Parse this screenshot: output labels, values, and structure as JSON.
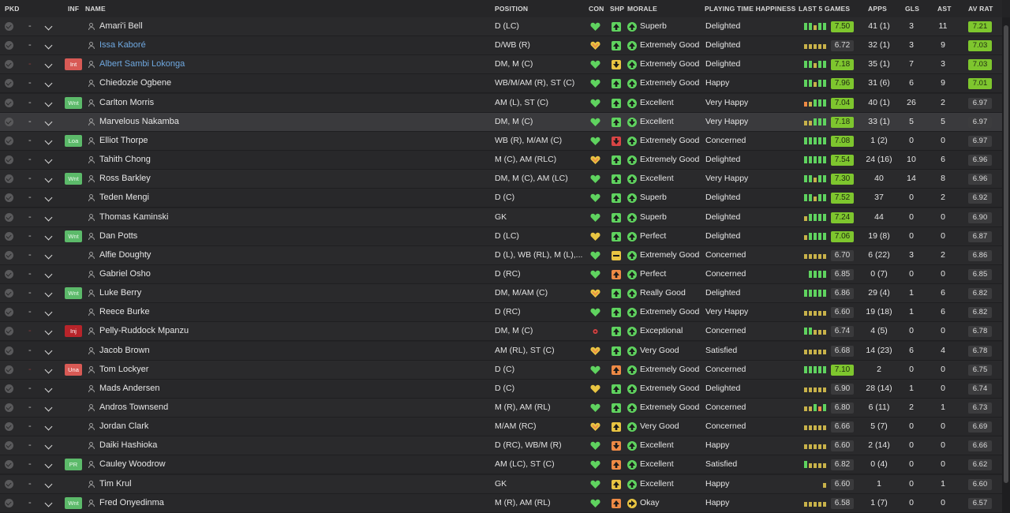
{
  "headers": {
    "pkd": "PKD",
    "inf": "INF",
    "name": "NAME",
    "position": "POSITION",
    "con": "CON",
    "shp": "SHP",
    "morale": "MORALE",
    "pth": "PLAYING TIME HAPPINESS",
    "l5": "LAST 5 GAMES",
    "apps": "APPS",
    "gls": "GLS",
    "ast": "AST",
    "avrat": "AV RAT"
  },
  "colors": {
    "green": "#5fd35f",
    "yellow": "#e9c542",
    "orange": "#ee8a45",
    "red": "#d84545",
    "rating_green": "#7ec62e"
  },
  "players": [
    {
      "name": "Amari'i Bell",
      "pos": "D (LC)",
      "con": "green",
      "shp": "green",
      "shp_icon": "up",
      "mor": "green",
      "mor_icon": "up",
      "morale": "Superb",
      "pth": "Delighted",
      "l5": [
        "g",
        "g",
        "y",
        "g",
        "g"
      ],
      "rating": "7.50",
      "apps": "41 (1)",
      "gls": "3",
      "ast": "11",
      "av": "7.21",
      "dash": "-",
      "inf": "",
      "blue": false
    },
    {
      "name": "Issa Kaboré",
      "pos": "D/WB (R)",
      "con": "orange-yellow",
      "shp": "green",
      "shp_icon": "up",
      "mor": "green",
      "mor_icon": "up",
      "morale": "Extremely Good",
      "pth": "Delighted",
      "l5": [
        "y",
        "y",
        "y",
        "y",
        "y"
      ],
      "rating": "6.72",
      "apps": "32 (1)",
      "gls": "3",
      "ast": "9",
      "av": "7.03",
      "dash": "-",
      "inf": "",
      "blue": true
    },
    {
      "name": "Albert Sambi Lokonga",
      "pos": "DM, M (C)",
      "con": "green",
      "shp": "yellow",
      "shp_icon": "down",
      "mor": "green",
      "mor_icon": "up",
      "morale": "Extremely Good",
      "pth": "Delighted",
      "l5": [
        "g",
        "g",
        "y",
        "g",
        "g"
      ],
      "rating": "7.18",
      "apps": "35 (1)",
      "gls": "7",
      "ast": "3",
      "av": "7.03",
      "dash": "-",
      "inf": "Int",
      "blue": true,
      "dashred": true
    },
    {
      "name": "Chiedozie Ogbene",
      "pos": "WB/M/AM (R), ST (C)",
      "con": "green",
      "shp": "green",
      "shp_icon": "up",
      "mor": "green",
      "mor_icon": "up",
      "morale": "Extremely Good",
      "pth": "Happy",
      "l5": [
        "g",
        "g",
        "y",
        "g",
        "g"
      ],
      "rating": "7.96",
      "apps": "31 (6)",
      "gls": "6",
      "ast": "9",
      "av": "7.01",
      "dash": "-",
      "inf": "",
      "blue": false
    },
    {
      "name": "Carlton Morris",
      "pos": "AM (L), ST (C)",
      "con": "green",
      "shp": "green",
      "shp_icon": "up",
      "mor": "green",
      "mor_icon": "up",
      "morale": "Excellent",
      "pth": "Very Happy",
      "l5": [
        "o",
        "y",
        "g",
        "g",
        "g"
      ],
      "rating": "7.04",
      "apps": "40 (1)",
      "gls": "26",
      "ast": "2",
      "av": "6.97",
      "dash": "-",
      "inf": "Wnt",
      "blue": false
    },
    {
      "name": "Marvelous Nakamba",
      "pos": "DM, M (C)",
      "con": "green",
      "shp": "green",
      "shp_icon": "up",
      "mor": "green",
      "mor_icon": "down",
      "morale": "Excellent",
      "pth": "Very Happy",
      "l5": [
        "y",
        "y",
        "g",
        "g",
        "g"
      ],
      "rating": "7.18",
      "apps": "33 (1)",
      "gls": "5",
      "ast": "5",
      "av": "6.97",
      "dash": "-",
      "inf": "",
      "blue": false,
      "hl": true
    },
    {
      "name": "Elliot Thorpe",
      "pos": "WB (R), M/AM (C)",
      "con": "green",
      "shp": "red",
      "shp_icon": "down",
      "mor": "green",
      "mor_icon": "up",
      "morale": "Extremely Good",
      "pth": "Concerned",
      "l5": [
        "g",
        "g",
        "g",
        "g",
        "g"
      ],
      "rating": "7.08",
      "apps": "1 (2)",
      "gls": "0",
      "ast": "0",
      "av": "6.97",
      "dash": "-",
      "inf": "Loa",
      "blue": false
    },
    {
      "name": "Tahith Chong",
      "pos": "M (C), AM (RLC)",
      "con": "orange-yellow",
      "shp": "green",
      "shp_icon": "up",
      "mor": "green",
      "mor_icon": "up",
      "morale": "Extremely Good",
      "pth": "Delighted",
      "l5": [
        "g",
        "g",
        "g",
        "g",
        "g"
      ],
      "rating": "7.54",
      "apps": "24 (16)",
      "gls": "10",
      "ast": "6",
      "av": "6.96",
      "dash": "-",
      "inf": "",
      "blue": false
    },
    {
      "name": "Ross Barkley",
      "pos": "DM, M (C), AM (LC)",
      "con": "green",
      "shp": "green",
      "shp_icon": "up",
      "mor": "green",
      "mor_icon": "up",
      "morale": "Excellent",
      "pth": "Very Happy",
      "l5": [
        "g",
        "g",
        "y",
        "g",
        "g"
      ],
      "rating": "7.30",
      "apps": "40",
      "gls": "14",
      "ast": "8",
      "av": "6.96",
      "dash": "-",
      "inf": "Wnt",
      "blue": false
    },
    {
      "name": "Teden Mengi",
      "pos": "D (C)",
      "con": "green",
      "shp": "green",
      "shp_icon": "up",
      "mor": "green",
      "mor_icon": "up",
      "morale": "Superb",
      "pth": "Delighted",
      "l5": [
        "g",
        "g",
        "y",
        "g",
        "g"
      ],
      "rating": "7.52",
      "apps": "37",
      "gls": "0",
      "ast": "2",
      "av": "6.92",
      "dash": "-",
      "inf": "",
      "blue": false
    },
    {
      "name": "Thomas Kaminski",
      "pos": "GK",
      "con": "green",
      "shp": "green",
      "shp_icon": "up",
      "mor": "green",
      "mor_icon": "up",
      "morale": "Superb",
      "pth": "Delighted",
      "l5": [
        "y",
        "g",
        "g",
        "g",
        "g"
      ],
      "rating": "7.24",
      "apps": "44",
      "gls": "0",
      "ast": "0",
      "av": "6.90",
      "dash": "-",
      "inf": "",
      "blue": false
    },
    {
      "name": "Dan Potts",
      "pos": "D (LC)",
      "con": "yellow",
      "shp": "green",
      "shp_icon": "up",
      "mor": "green",
      "mor_icon": "up",
      "morale": "Perfect",
      "pth": "Delighted",
      "l5": [
        "y",
        "g",
        "g",
        "g",
        "g"
      ],
      "rating": "7.06",
      "apps": "19 (8)",
      "gls": "0",
      "ast": "0",
      "av": "6.87",
      "dash": "-",
      "inf": "Wnt",
      "blue": false
    },
    {
      "name": "Alfie Doughty",
      "pos": "D (L), WB (RL), M (L),...",
      "con": "green",
      "shp": "yellow",
      "shp_icon": "flat",
      "mor": "green",
      "mor_icon": "up",
      "morale": "Extremely Good",
      "pth": "Concerned",
      "l5": [
        "y",
        "y",
        "y",
        "y",
        "y"
      ],
      "rating": "6.70",
      "apps": "6 (22)",
      "gls": "3",
      "ast": "2",
      "av": "6.86",
      "dash": "-",
      "inf": "",
      "blue": false
    },
    {
      "name": "Gabriel Osho",
      "pos": "D (RC)",
      "con": "green",
      "shp": "orange",
      "shp_icon": "up",
      "mor": "green",
      "mor_icon": "up",
      "morale": "Perfect",
      "pth": "Concerned",
      "l5": [
        "g",
        "g",
        "g",
        "g"
      ],
      "rating": "6.85",
      "apps": "0 (7)",
      "gls": "0",
      "ast": "0",
      "av": "6.85",
      "dash": "-",
      "inf": "",
      "blue": false
    },
    {
      "name": "Luke Berry",
      "pos": "DM, M/AM (C)",
      "con": "orange-yellow",
      "shp": "green",
      "shp_icon": "up",
      "mor": "green",
      "mor_icon": "up",
      "morale": "Really Good",
      "pth": "Delighted",
      "l5": [
        "g",
        "g",
        "g",
        "g",
        "g"
      ],
      "rating": "6.86",
      "apps": "29 (4)",
      "gls": "1",
      "ast": "6",
      "av": "6.82",
      "dash": "-",
      "inf": "Wnt",
      "blue": false
    },
    {
      "name": "Reece Burke",
      "pos": "D (RC)",
      "con": "green",
      "shp": "green",
      "shp_icon": "up",
      "mor": "green",
      "mor_icon": "up",
      "morale": "Extremely Good",
      "pth": "Very Happy",
      "l5": [
        "y",
        "y",
        "y",
        "y",
        "y"
      ],
      "rating": "6.60",
      "apps": "19 (18)",
      "gls": "1",
      "ast": "6",
      "av": "6.82",
      "dash": "-",
      "inf": "",
      "blue": false
    },
    {
      "name": "Pelly-Ruddock Mpanzu",
      "pos": "DM, M (C)",
      "con": "red-dot",
      "shp": "green",
      "shp_icon": "up",
      "mor": "green",
      "mor_icon": "up",
      "morale": "Exceptional",
      "pth": "Concerned",
      "l5": [
        "g",
        "g",
        "y",
        "y",
        "y"
      ],
      "rating": "6.74",
      "apps": "4 (5)",
      "gls": "0",
      "ast": "0",
      "av": "6.78",
      "dash": "-",
      "inf": "Inj",
      "blue": false,
      "dashred": true
    },
    {
      "name": "Jacob Brown",
      "pos": "AM (RL), ST (C)",
      "con": "orange-yellow",
      "shp": "green",
      "shp_icon": "up",
      "mor": "green",
      "mor_icon": "up",
      "morale": "Very Good",
      "pth": "Satisfied",
      "l5": [
        "y",
        "y",
        "y",
        "y",
        "y"
      ],
      "rating": "6.68",
      "apps": "14 (23)",
      "gls": "6",
      "ast": "4",
      "av": "6.78",
      "dash": "-",
      "inf": "",
      "blue": false
    },
    {
      "name": "Tom Lockyer",
      "pos": "D (C)",
      "con": "green",
      "shp": "orange",
      "shp_icon": "up",
      "mor": "green",
      "mor_icon": "up",
      "morale": "Extremely Good",
      "pth": "Concerned",
      "l5": [
        "g",
        "g",
        "g",
        "g",
        "g"
      ],
      "rating": "7.10",
      "apps": "2",
      "gls": "0",
      "ast": "0",
      "av": "6.75",
      "dash": "-",
      "inf": "Una",
      "blue": false,
      "dashred": true
    },
    {
      "name": "Mads Andersen",
      "pos": "D (C)",
      "con": "yellow",
      "shp": "green",
      "shp_icon": "up",
      "mor": "green",
      "mor_icon": "up",
      "morale": "Extremely Good",
      "pth": "Delighted",
      "l5": [
        "y",
        "y",
        "y",
        "y",
        "y"
      ],
      "rating": "6.90",
      "apps": "28 (14)",
      "gls": "1",
      "ast": "0",
      "av": "6.74",
      "dash": "-",
      "inf": "",
      "blue": false
    },
    {
      "name": "Andros Townsend",
      "pos": "M (R), AM (RL)",
      "con": "green",
      "shp": "green",
      "shp_icon": "up",
      "mor": "green",
      "mor_icon": "up",
      "morale": "Extremely Good",
      "pth": "Concerned",
      "l5": [
        "y",
        "y",
        "g",
        "o",
        "g"
      ],
      "rating": "6.80",
      "apps": "6 (11)",
      "gls": "2",
      "ast": "1",
      "av": "6.73",
      "dash": "-",
      "inf": "",
      "blue": false
    },
    {
      "name": "Jordan Clark",
      "pos": "M/AM (RC)",
      "con": "orange-yellow",
      "shp": "yellow",
      "shp_icon": "up",
      "mor": "green",
      "mor_icon": "up",
      "morale": "Very Good",
      "pth": "Concerned",
      "l5": [
        "y",
        "y",
        "y",
        "y",
        "y"
      ],
      "rating": "6.66",
      "apps": "5 (7)",
      "gls": "0",
      "ast": "0",
      "av": "6.69",
      "dash": "-",
      "inf": "",
      "blue": false
    },
    {
      "name": "Daiki Hashioka",
      "pos": "D (RC), WB/M (R)",
      "con": "green",
      "shp": "orange",
      "shp_icon": "down",
      "mor": "green",
      "mor_icon": "up",
      "morale": "Excellent",
      "pth": "Happy",
      "l5": [
        "y",
        "y",
        "y",
        "y",
        "y"
      ],
      "rating": "6.60",
      "apps": "2 (14)",
      "gls": "0",
      "ast": "0",
      "av": "6.66",
      "dash": "-",
      "inf": "",
      "blue": false
    },
    {
      "name": "Cauley Woodrow",
      "pos": "AM (LC), ST (C)",
      "con": "green",
      "shp": "orange",
      "shp_icon": "up",
      "mor": "green",
      "mor_icon": "up",
      "morale": "Excellent",
      "pth": "Satisfied",
      "l5": [
        "g",
        "y",
        "y",
        "y",
        "y"
      ],
      "rating": "6.82",
      "apps": "0 (4)",
      "gls": "0",
      "ast": "0",
      "av": "6.62",
      "dash": "-",
      "inf": "PR",
      "blue": false
    },
    {
      "name": "Tim Krul",
      "pos": "GK",
      "con": "green",
      "shp": "yellow",
      "shp_icon": "up",
      "mor": "green",
      "mor_icon": "up",
      "morale": "Excellent",
      "pth": "Happy",
      "l5": [
        "y"
      ],
      "rating": "6.60",
      "apps": "1",
      "gls": "0",
      "ast": "1",
      "av": "6.60",
      "dash": "-",
      "inf": "",
      "blue": false
    },
    {
      "name": "Fred Onyedinma",
      "pos": "M (R), AM (RL)",
      "con": "green",
      "shp": "orange",
      "shp_icon": "up",
      "mor": "yellow",
      "mor_icon": "right",
      "morale": "Okay",
      "pth": "Happy",
      "l5": [
        "y",
        "y",
        "y",
        "y",
        "y"
      ],
      "rating": "6.58",
      "apps": "1 (7)",
      "gls": "0",
      "ast": "0",
      "av": "6.57",
      "dash": "-",
      "inf": "Wnt",
      "blue": false
    }
  ]
}
